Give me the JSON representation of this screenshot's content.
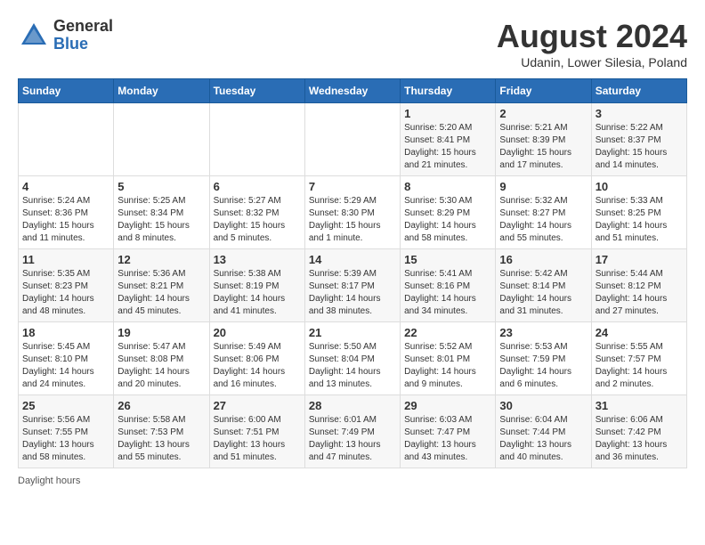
{
  "header": {
    "logo_general": "General",
    "logo_blue": "Blue",
    "month_title": "August 2024",
    "location": "Udanin, Lower Silesia, Poland"
  },
  "days_of_week": [
    "Sunday",
    "Monday",
    "Tuesday",
    "Wednesday",
    "Thursday",
    "Friday",
    "Saturday"
  ],
  "weeks": [
    [
      {
        "day": "",
        "info": ""
      },
      {
        "day": "",
        "info": ""
      },
      {
        "day": "",
        "info": ""
      },
      {
        "day": "",
        "info": ""
      },
      {
        "day": "1",
        "info": "Sunrise: 5:20 AM\nSunset: 8:41 PM\nDaylight: 15 hours\nand 21 minutes."
      },
      {
        "day": "2",
        "info": "Sunrise: 5:21 AM\nSunset: 8:39 PM\nDaylight: 15 hours\nand 17 minutes."
      },
      {
        "day": "3",
        "info": "Sunrise: 5:22 AM\nSunset: 8:37 PM\nDaylight: 15 hours\nand 14 minutes."
      }
    ],
    [
      {
        "day": "4",
        "info": "Sunrise: 5:24 AM\nSunset: 8:36 PM\nDaylight: 15 hours\nand 11 minutes."
      },
      {
        "day": "5",
        "info": "Sunrise: 5:25 AM\nSunset: 8:34 PM\nDaylight: 15 hours\nand 8 minutes."
      },
      {
        "day": "6",
        "info": "Sunrise: 5:27 AM\nSunset: 8:32 PM\nDaylight: 15 hours\nand 5 minutes."
      },
      {
        "day": "7",
        "info": "Sunrise: 5:29 AM\nSunset: 8:30 PM\nDaylight: 15 hours\nand 1 minute."
      },
      {
        "day": "8",
        "info": "Sunrise: 5:30 AM\nSunset: 8:29 PM\nDaylight: 14 hours\nand 58 minutes."
      },
      {
        "day": "9",
        "info": "Sunrise: 5:32 AM\nSunset: 8:27 PM\nDaylight: 14 hours\nand 55 minutes."
      },
      {
        "day": "10",
        "info": "Sunrise: 5:33 AM\nSunset: 8:25 PM\nDaylight: 14 hours\nand 51 minutes."
      }
    ],
    [
      {
        "day": "11",
        "info": "Sunrise: 5:35 AM\nSunset: 8:23 PM\nDaylight: 14 hours\nand 48 minutes."
      },
      {
        "day": "12",
        "info": "Sunrise: 5:36 AM\nSunset: 8:21 PM\nDaylight: 14 hours\nand 45 minutes."
      },
      {
        "day": "13",
        "info": "Sunrise: 5:38 AM\nSunset: 8:19 PM\nDaylight: 14 hours\nand 41 minutes."
      },
      {
        "day": "14",
        "info": "Sunrise: 5:39 AM\nSunset: 8:17 PM\nDaylight: 14 hours\nand 38 minutes."
      },
      {
        "day": "15",
        "info": "Sunrise: 5:41 AM\nSunset: 8:16 PM\nDaylight: 14 hours\nand 34 minutes."
      },
      {
        "day": "16",
        "info": "Sunrise: 5:42 AM\nSunset: 8:14 PM\nDaylight: 14 hours\nand 31 minutes."
      },
      {
        "day": "17",
        "info": "Sunrise: 5:44 AM\nSunset: 8:12 PM\nDaylight: 14 hours\nand 27 minutes."
      }
    ],
    [
      {
        "day": "18",
        "info": "Sunrise: 5:45 AM\nSunset: 8:10 PM\nDaylight: 14 hours\nand 24 minutes."
      },
      {
        "day": "19",
        "info": "Sunrise: 5:47 AM\nSunset: 8:08 PM\nDaylight: 14 hours\nand 20 minutes."
      },
      {
        "day": "20",
        "info": "Sunrise: 5:49 AM\nSunset: 8:06 PM\nDaylight: 14 hours\nand 16 minutes."
      },
      {
        "day": "21",
        "info": "Sunrise: 5:50 AM\nSunset: 8:04 PM\nDaylight: 14 hours\nand 13 minutes."
      },
      {
        "day": "22",
        "info": "Sunrise: 5:52 AM\nSunset: 8:01 PM\nDaylight: 14 hours\nand 9 minutes."
      },
      {
        "day": "23",
        "info": "Sunrise: 5:53 AM\nSunset: 7:59 PM\nDaylight: 14 hours\nand 6 minutes."
      },
      {
        "day": "24",
        "info": "Sunrise: 5:55 AM\nSunset: 7:57 PM\nDaylight: 14 hours\nand 2 minutes."
      }
    ],
    [
      {
        "day": "25",
        "info": "Sunrise: 5:56 AM\nSunset: 7:55 PM\nDaylight: 13 hours\nand 58 minutes."
      },
      {
        "day": "26",
        "info": "Sunrise: 5:58 AM\nSunset: 7:53 PM\nDaylight: 13 hours\nand 55 minutes."
      },
      {
        "day": "27",
        "info": "Sunrise: 6:00 AM\nSunset: 7:51 PM\nDaylight: 13 hours\nand 51 minutes."
      },
      {
        "day": "28",
        "info": "Sunrise: 6:01 AM\nSunset: 7:49 PM\nDaylight: 13 hours\nand 47 minutes."
      },
      {
        "day": "29",
        "info": "Sunrise: 6:03 AM\nSunset: 7:47 PM\nDaylight: 13 hours\nand 43 minutes."
      },
      {
        "day": "30",
        "info": "Sunrise: 6:04 AM\nSunset: 7:44 PM\nDaylight: 13 hours\nand 40 minutes."
      },
      {
        "day": "31",
        "info": "Sunrise: 6:06 AM\nSunset: 7:42 PM\nDaylight: 13 hours\nand 36 minutes."
      }
    ]
  ],
  "footer": {
    "daylight_label": "Daylight hours"
  }
}
